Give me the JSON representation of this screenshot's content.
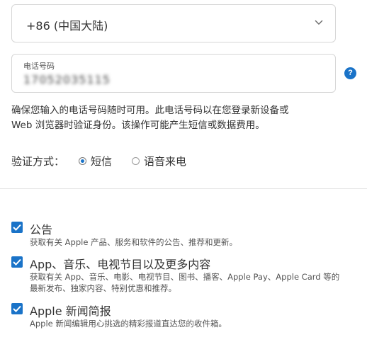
{
  "country_select": {
    "value": "+86 (中国大陆)"
  },
  "phone_field": {
    "label": "电话号码",
    "value": "17052035115"
  },
  "help": {
    "symbol": "?"
  },
  "notice": {
    "line1": "确保您输入的电话号码随时可用。此电话号码以在您登录新设备或",
    "line2": "Web 浏览器时验证身份。该操作可能产生短信或数据费用。"
  },
  "verify": {
    "label": "验证方式：",
    "options": [
      {
        "label": "短信",
        "selected": true
      },
      {
        "label": "语音来电",
        "selected": false
      }
    ]
  },
  "subscriptions": [
    {
      "title": "公告",
      "checked": true,
      "description": "获取有关 Apple 产品、服务和软件的公告、推荐和更新。"
    },
    {
      "title": "App、音乐、电视节目以及更多内容",
      "checked": true,
      "description": "获取有关 App、音乐、电影、电视节目、图书、播客、Apple Pay、Apple Card 等的最新发布、独家内容、特别优惠和推荐。"
    },
    {
      "title": "Apple 新闻简报",
      "checked": true,
      "description": "Apple 新闻编辑用心挑选的精彩报道直达您的收件箱。"
    }
  ],
  "colors": {
    "accent": "#1a73c8",
    "border": "#d6d6d6"
  }
}
